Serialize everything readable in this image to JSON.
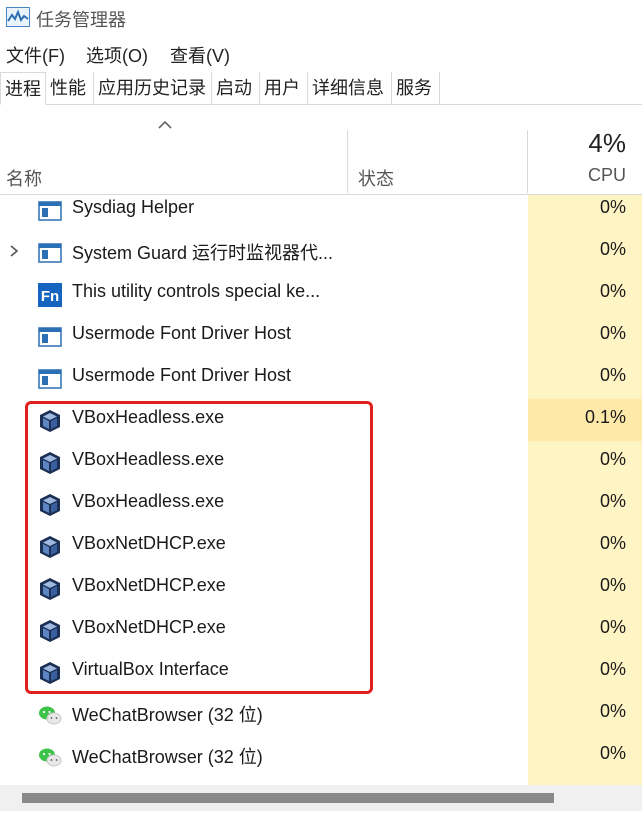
{
  "window": {
    "title": "任务管理器"
  },
  "menu": [
    "文件(F)",
    "选项(O)",
    "查看(V)"
  ],
  "tabs": [
    "进程",
    "性能",
    "应用历史记录",
    "启动",
    "用户",
    "详细信息",
    "服务"
  ],
  "active_tab": "进程",
  "columns": {
    "name": "名称",
    "status": "状态",
    "cpu_total": "4%",
    "cpu": "CPU"
  },
  "colors": {
    "cpu_column": "#fff4c4",
    "cpu_highlight": "#ffe9a8",
    "annotation_box": "#e0201c"
  },
  "rows": [
    {
      "name": "Sysdiag Helper",
      "cpu": "0%",
      "icon": "window-app-icon",
      "expandable": false
    },
    {
      "name": "System Guard 运行时监视器代...",
      "cpu": "0%",
      "icon": "window-app-icon",
      "expandable": true
    },
    {
      "name": "This utility controls special ke...",
      "cpu": "0%",
      "icon": "fn-key-icon",
      "expandable": false
    },
    {
      "name": "Usermode Font Driver Host",
      "cpu": "0%",
      "icon": "window-app-icon",
      "expandable": false
    },
    {
      "name": "Usermode Font Driver Host",
      "cpu": "0%",
      "icon": "window-app-icon",
      "expandable": false
    },
    {
      "name": "VBoxHeadless.exe",
      "cpu": "0.1%",
      "icon": "virtualbox-cube-icon",
      "expandable": false
    },
    {
      "name": "VBoxHeadless.exe",
      "cpu": "0%",
      "icon": "virtualbox-cube-icon",
      "expandable": false
    },
    {
      "name": "VBoxHeadless.exe",
      "cpu": "0%",
      "icon": "virtualbox-cube-icon",
      "expandable": false
    },
    {
      "name": "VBoxNetDHCP.exe",
      "cpu": "0%",
      "icon": "virtualbox-cube-icon",
      "expandable": false
    },
    {
      "name": "VBoxNetDHCP.exe",
      "cpu": "0%",
      "icon": "virtualbox-cube-icon",
      "expandable": false
    },
    {
      "name": "VBoxNetDHCP.exe",
      "cpu": "0%",
      "icon": "virtualbox-cube-icon",
      "expandable": false
    },
    {
      "name": "VirtualBox Interface",
      "cpu": "0%",
      "icon": "virtualbox-cube-icon",
      "expandable": false
    },
    {
      "name": "WeChatBrowser (32 位)",
      "cpu": "0%",
      "icon": "wechat-icon",
      "expandable": false
    },
    {
      "name": "WeChatBrowser (32 位)",
      "cpu": "0%",
      "icon": "wechat-icon",
      "expandable": false
    }
  ]
}
